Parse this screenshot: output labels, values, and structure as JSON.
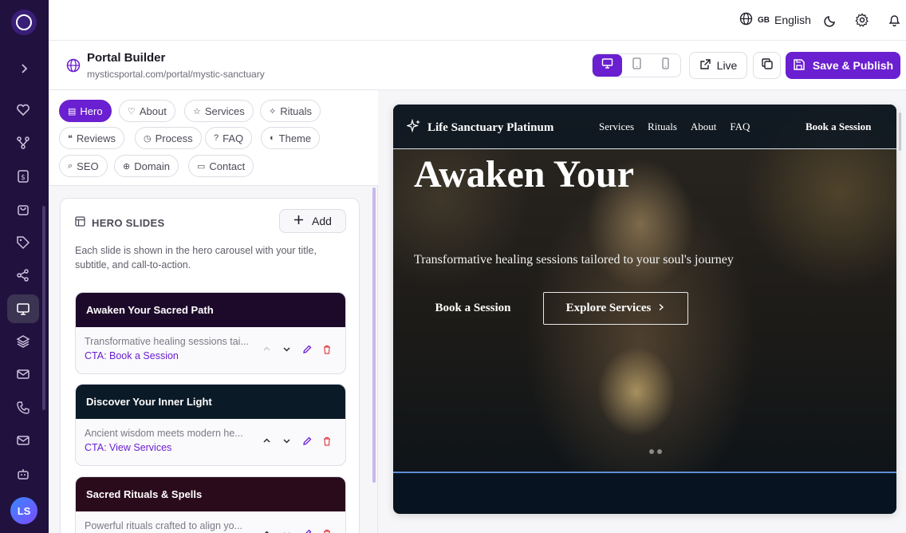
{
  "app": {
    "logo": "brand-logo"
  },
  "rail": {
    "items": [
      {
        "icon": "heart-icon"
      },
      {
        "icon": "network-icon"
      },
      {
        "icon": "dollar-icon"
      },
      {
        "icon": "shopping-bag-icon"
      },
      {
        "icon": "tag-icon"
      },
      {
        "icon": "share-icon"
      },
      {
        "icon": "monitor-icon",
        "active": true
      },
      {
        "icon": "layers-icon"
      },
      {
        "icon": "mail-icon"
      },
      {
        "icon": "phone-icon"
      },
      {
        "icon": "mail-icon"
      },
      {
        "icon": "bot-icon"
      }
    ],
    "avatar_initials": "LS"
  },
  "topbar": {
    "language_flag": "GB",
    "language": "English"
  },
  "header": {
    "title": "Portal Builder",
    "url": "mysticsportal.com/portal/mystic-sanctuary",
    "live_label": "Live",
    "save_label": "Save & Publish"
  },
  "tabs": [
    {
      "label": "Hero",
      "icon": "▤",
      "active": true
    },
    {
      "label": "About",
      "icon": "♡"
    },
    {
      "label": "Services",
      "icon": "☆"
    },
    {
      "label": "Rituals",
      "icon": "✧"
    },
    {
      "label": "Reviews",
      "icon": "❝"
    },
    {
      "label": "Process",
      "icon": "◷"
    },
    {
      "label": "FAQ",
      "icon": "?"
    },
    {
      "label": "Theme",
      "icon": "◐"
    },
    {
      "label": "SEO",
      "icon": "⌕"
    },
    {
      "label": "Domain",
      "icon": "⊕"
    },
    {
      "label": "Contact",
      "icon": "▭"
    }
  ],
  "hero_slides": {
    "heading": "HERO SLIDES",
    "add_label": "Add",
    "description": "Each slide is shown in the hero carousel with your title, subtitle, and call-to-action.",
    "slides": [
      {
        "title": "Awaken Your Sacred Path",
        "subtitle": "Transformative healing sessions tai...",
        "cta": "CTA: Book a Session",
        "color": "#1d0a2b"
      },
      {
        "title": "Discover Your Inner Light",
        "subtitle": "Ancient wisdom meets modern he...",
        "cta": "CTA: View Services",
        "color": "#0b1a27"
      },
      {
        "title": "Sacred Rituals & Spells",
        "subtitle": "Powerful rituals crafted to align yo...",
        "cta": "",
        "color": "#2a0b1c"
      }
    ]
  },
  "preview": {
    "brand": "Life Sanctuary Platinum",
    "nav": [
      "Services",
      "Rituals",
      "About",
      "FAQ"
    ],
    "nav_cta": "Book a Session",
    "hero_title": "Awaken Your",
    "hero_subtitle": "Transformative healing sessions tailored to your soul's journey",
    "primary_button": "Book a Session",
    "secondary_button": "Explore Services",
    "slide_count": 2
  },
  "colors": {
    "accent": "#6a1fd0",
    "rail": "#21113f"
  }
}
